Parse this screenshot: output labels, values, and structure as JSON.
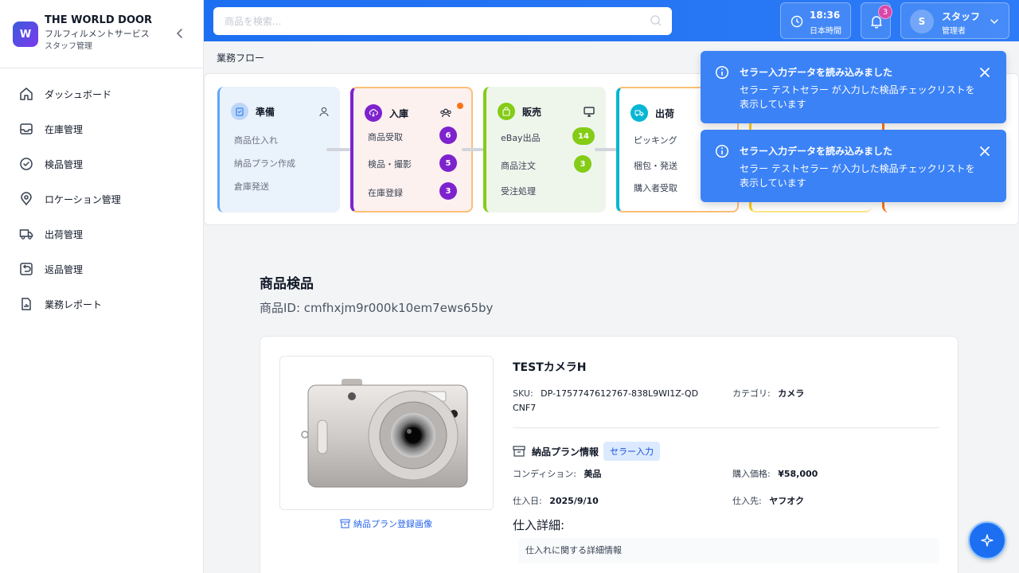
{
  "brand": {
    "logo_letter": "W",
    "title": "THE WORLD DOOR",
    "subtitle": "フルフィルメントサービス",
    "role": "スタッフ管理"
  },
  "sidebar": {
    "items": [
      {
        "label": "ダッシュボード",
        "icon": "home-icon"
      },
      {
        "label": "在庫管理",
        "icon": "inbox-icon"
      },
      {
        "label": "検品管理",
        "icon": "check-circle-icon"
      },
      {
        "label": "ロケーション管理",
        "icon": "location-pin-icon"
      },
      {
        "label": "出荷管理",
        "icon": "truck-icon"
      },
      {
        "label": "返品管理",
        "icon": "return-icon"
      },
      {
        "label": "業務レポート",
        "icon": "report-icon"
      }
    ]
  },
  "header": {
    "search_placeholder": "商品を検索...",
    "time": "18:36",
    "time_label": "日本時間",
    "notification_count": "3",
    "user_initial": "S",
    "user_name": "スタッフ",
    "user_role": "管理者"
  },
  "workflow": {
    "title": "業務フロー",
    "stages": [
      {
        "name": "準備",
        "rows": [
          "商品仕入れ",
          "納品プラン作成",
          "倉庫発送"
        ]
      },
      {
        "name": "入庫",
        "rows": [
          {
            "label": "商品受取",
            "count": "6"
          },
          {
            "label": "検品・撮影",
            "count": "5"
          },
          {
            "label": "在庫登録",
            "count": "3"
          }
        ]
      },
      {
        "name": "販売",
        "rows": [
          {
            "label": "eBay出品",
            "count": "14"
          },
          {
            "label": "商品注文",
            "count": "3"
          },
          {
            "label": "受注処理"
          }
        ]
      },
      {
        "name": "出荷",
        "rows": [
          "ピッキング",
          "梱包・発送",
          "購入者受取"
        ]
      }
    ]
  },
  "toasts": [
    {
      "title": "セラー入力データを読み込みました",
      "body": "セラー テストセラー が入力した検品チェックリストを表示しています"
    },
    {
      "title": "セラー入力データを読み込みました",
      "body": "セラー テストセラー が入力した検品チェックリストを表示しています"
    }
  ],
  "page": {
    "title": "商品検品",
    "product_id": "商品ID: cmfhxjm9r000k10em7ews65by"
  },
  "product": {
    "name": "TESTカメラH",
    "photo_link": "納品プラン登録画像",
    "sku_label": "SKU:",
    "sku": "DP-1757747612767-838L9WI1Z-QDCNF7",
    "category_label": "カテゴリ:",
    "category": "カメラ",
    "plan_title": "納品プラン情報",
    "plan_badge": "セラー入力",
    "condition_label": "コンディション:",
    "condition": "美品",
    "price_label": "購入価格:",
    "price": "¥58,000",
    "purchase_date_label": "仕入日:",
    "purchase_date": "2025/9/10",
    "supplier_label": "仕入先:",
    "supplier": "ヤフオク",
    "detail_label": "仕入詳細:",
    "detail_text": "仕入れに関する詳細情報"
  },
  "colors": {
    "header_blue": "#1d6ff2",
    "toast_blue": "#3b82f6",
    "stage_prep": "#3b82f6",
    "stage_receive": "#7e22ce",
    "stage_sales": "#65a30d",
    "stage_ship": "#06b6d4"
  }
}
